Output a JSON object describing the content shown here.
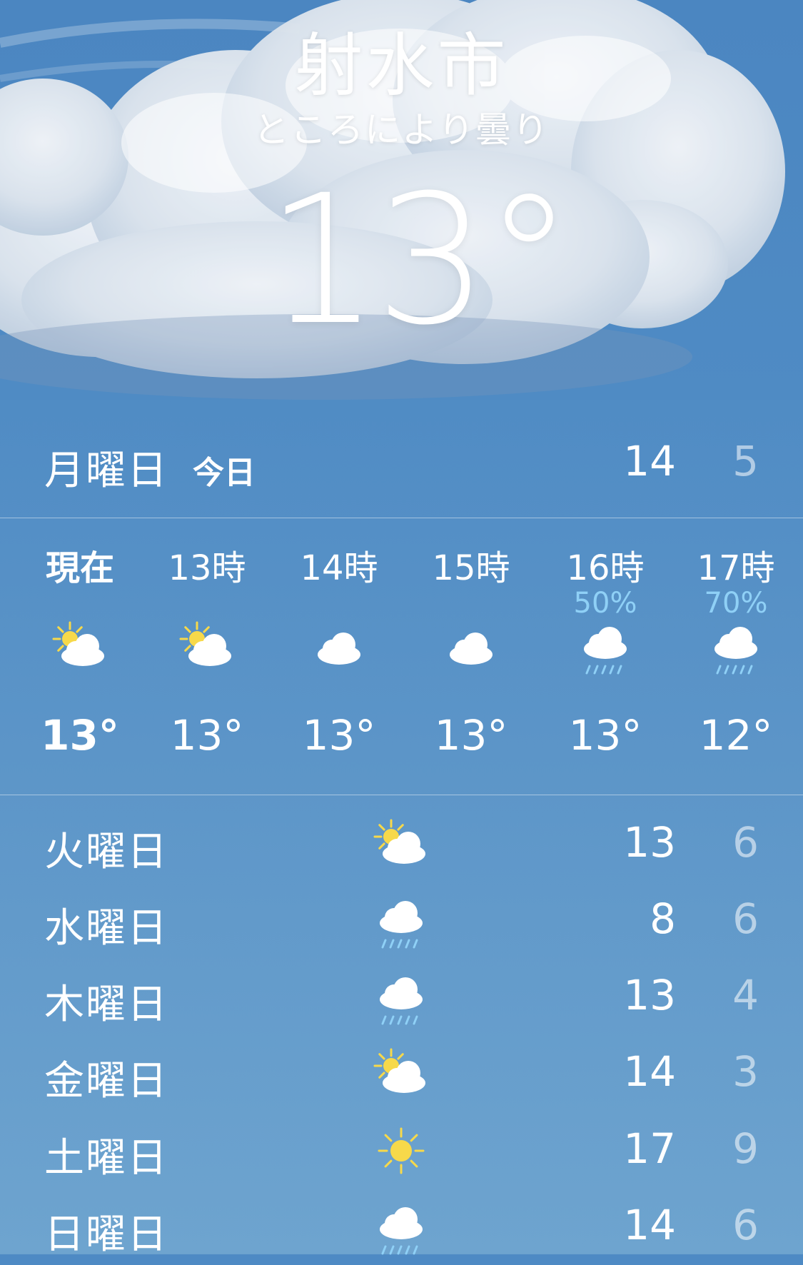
{
  "location": {
    "city": "射水市",
    "condition": "ところにより曇り",
    "current_temp": "13°"
  },
  "today": {
    "day": "月曜日",
    "label": "今日",
    "high": "14",
    "low": "5"
  },
  "hourly": [
    {
      "time": "現在",
      "icon": "partly-sunny-icon",
      "precip": "",
      "temp": "13°",
      "bold": true
    },
    {
      "time": "13時",
      "icon": "partly-sunny-icon",
      "precip": "",
      "temp": "13°",
      "bold": false
    },
    {
      "time": "14時",
      "icon": "cloud-icon",
      "precip": "",
      "temp": "13°",
      "bold": false
    },
    {
      "time": "15時",
      "icon": "cloud-icon",
      "precip": "",
      "temp": "13°",
      "bold": false
    },
    {
      "time": "16時",
      "icon": "rain-cloud-icon",
      "precip": "50%",
      "temp": "13°",
      "bold": false
    },
    {
      "time": "17時",
      "icon": "rain-cloud-icon",
      "precip": "70%",
      "temp": "12°",
      "bold": false
    }
  ],
  "daily": [
    {
      "day": "火曜日",
      "icon": "partly-sunny-icon",
      "high": "13",
      "low": "6"
    },
    {
      "day": "水曜日",
      "icon": "rain-cloud-icon",
      "high": "8",
      "low": "6"
    },
    {
      "day": "木曜日",
      "icon": "rain-cloud-icon",
      "high": "13",
      "low": "4"
    },
    {
      "day": "金曜日",
      "icon": "partly-sunny-icon",
      "high": "14",
      "low": "3"
    },
    {
      "day": "土曜日",
      "icon": "sun-icon",
      "high": "17",
      "low": "9"
    },
    {
      "day": "日曜日",
      "icon": "rain-cloud-icon",
      "high": "14",
      "low": "6"
    }
  ],
  "colors": {
    "sky_top": "#4e8ac4",
    "sky_bottom": "#6ea4cf",
    "precip_text": "#8fd0f6",
    "sun": "#f7d94a",
    "rain": "#8fd0f6"
  }
}
